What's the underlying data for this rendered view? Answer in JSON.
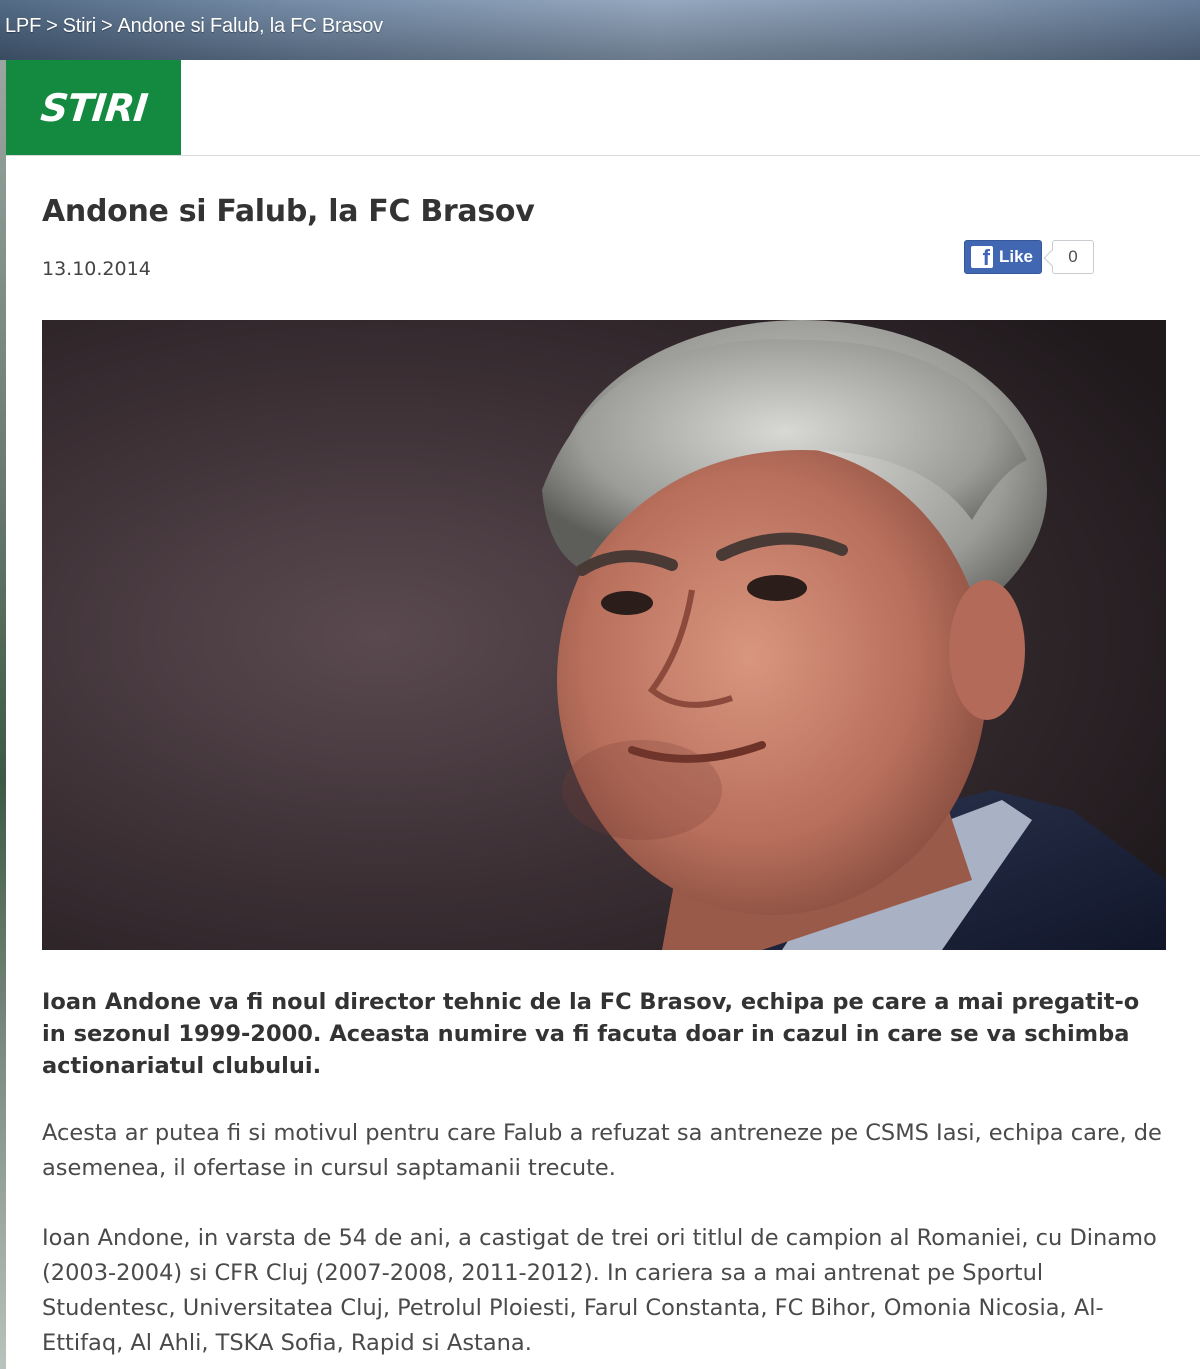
{
  "breadcrumb": {
    "items": [
      "LPF",
      "Stiri",
      "Andone si Falub, la FC Brasov"
    ],
    "separator": ">"
  },
  "section": {
    "label": "STIRI",
    "color": "#138a3f"
  },
  "article": {
    "title": "Andone si Falub, la FC Brasov",
    "date": "13.10.2014",
    "lead": "Ioan Andone va fi noul director tehnic de la FC Brasov, echipa pe care a mai pregatit-o in sezonul 1999-2000. Aceasta numire va fi facuta doar in cazul in care se va schimba actionariatul clubului.",
    "paragraphs": [
      "Acesta ar putea fi si motivul pentru care Falub a refuzat sa antreneze pe CSMS Iasi, echipa care, de asemenea, il ofertase in cursul saptamanii trecute.",
      "Ioan Andone, in varsta de 54 de ani, a castigat de trei ori titlul de campion al Romaniei, cu Dinamo (2003-2004) si CFR Cluj (2007-2008, 2011-2012). In cariera sa a mai antrenat pe Sportul Studentesc, Universitatea Cluj, Petrolul Ploiesti, Farul Constanta, FC Bihor, Omonia Nicosia, Al-Ettifaq, Al Ahli, TSKA Sofia, Rapid si Astana."
    ]
  },
  "facebook": {
    "like_label": "Like",
    "like_count": "0",
    "icon": "facebook-icon",
    "color": "#4267b2"
  }
}
